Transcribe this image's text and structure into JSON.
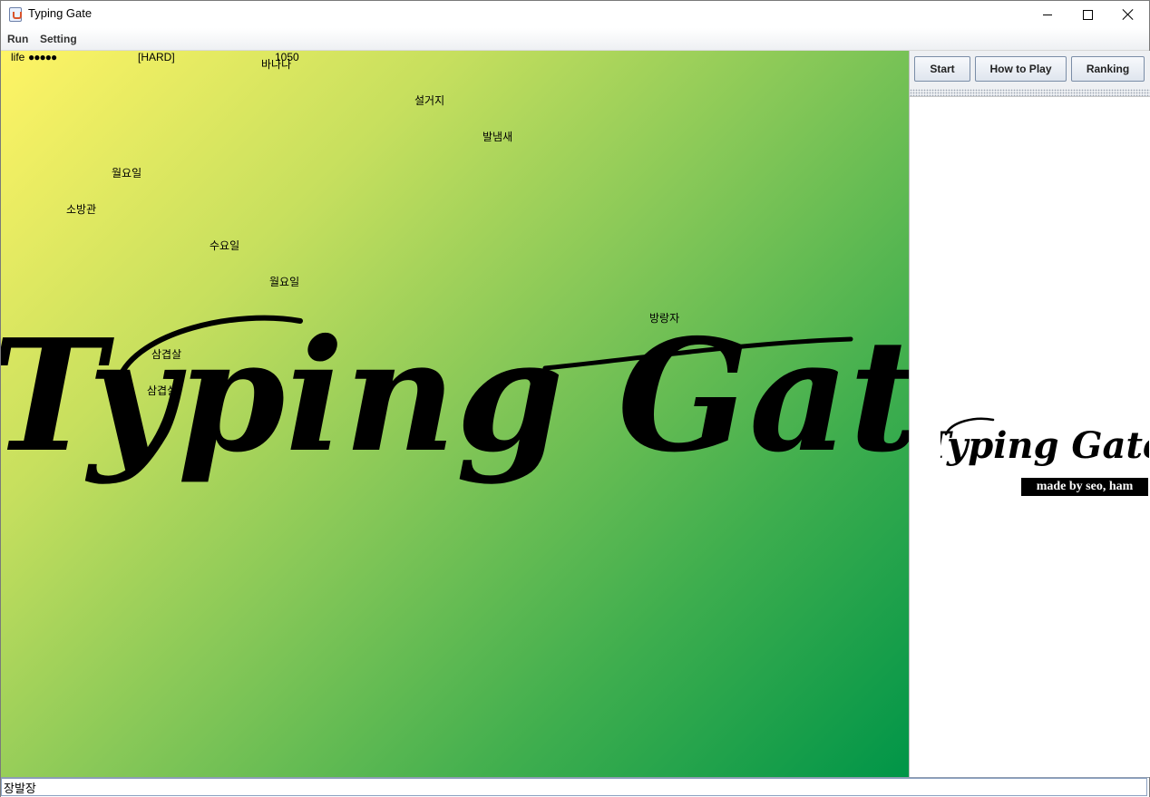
{
  "window": {
    "title": "Typing Gate"
  },
  "menu": {
    "items": [
      "Run",
      "Setting"
    ]
  },
  "hud": {
    "life_label": "life",
    "life_dots": "●●●●●",
    "level": "[HARD]",
    "score": "1050"
  },
  "falling_words": [
    "바나나",
    "설거지",
    "발냄새",
    "월요일",
    "소방관",
    "수요일",
    "월요일",
    "방랑자",
    "삼겹살",
    "삼겹살"
  ],
  "logo": {
    "text": "Typing Gate",
    "credit": "made by seo, ham"
  },
  "side_buttons": {
    "start": "Start",
    "howto": "How to Play",
    "ranking": "Ranking"
  },
  "input": {
    "value": "장발장"
  },
  "colors": {
    "gradient_start": "#fff465",
    "gradient_end": "#009548",
    "button_border": "#7a8da7"
  }
}
